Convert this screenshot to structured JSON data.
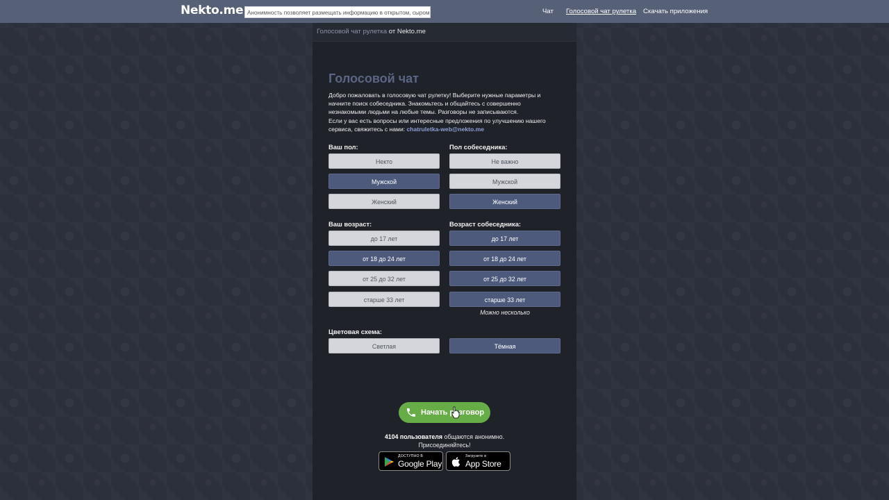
{
  "header": {
    "logo": "Nekto.me",
    "notice": "Анонимность позволяет размещать информацию в открытом, сыром виде!",
    "nav": [
      {
        "label": "Чат"
      },
      {
        "label": "Голосовой чат рулетка"
      },
      {
        "label": "Скачать приложения"
      }
    ]
  },
  "breadcrumb": {
    "link": "Голосовой чат рулетка",
    "rest": " от Nekto.me"
  },
  "main": {
    "title": "Голосовой чат",
    "intro_text": "Добро пожаловать в голосовую чат рулетку! Выберите нужные параметры и начните поиск собеседника. Знакомьтесь и общайтесь с совершенно незнакомыми людьми на любые темы. Разговоры не записываются.",
    "contact_text": "Если у вас есть вопросы или интересные предложения по улучшению нашего сервиса, свяжитесь с нами: ",
    "email": "chatruletka-web@nekto.me"
  },
  "your_sex": {
    "label": "Ваш пол:",
    "options": [
      "Некто",
      "Мужской",
      "Женский"
    ],
    "selected": "Мужской"
  },
  "partner_sex": {
    "label": "Пол собеседника:",
    "options": [
      "Не важно",
      "Мужской",
      "Женский"
    ],
    "selected": "Женский"
  },
  "your_age": {
    "label": "Ваш возраст:",
    "options": [
      "до 17 лет",
      "от 18 до 24 лет",
      "от 25 до 32 лет",
      "старше 33 лет"
    ],
    "selected": "от 18 до 24 лет"
  },
  "partner_age": {
    "label": "Возраст собеседника:",
    "options": [
      "до 17 лет",
      "от 18 до 24 лет",
      "от 25 до 32 лет",
      "старше 33 лет"
    ],
    "selected": [
      "до 17 лет",
      "от 18 до 24 лет",
      "от 25 до 32 лет",
      "старше 33 лет"
    ],
    "hint": "Можно несколько"
  },
  "color_scheme": {
    "label": "Цветовая схема:",
    "options": [
      "Светлая",
      "Тёмная"
    ],
    "selected": "Тёмная"
  },
  "start": {
    "label": "Начать разговор",
    "icon": "phone-icon"
  },
  "online": {
    "count_text": "4104 пользователя",
    "rest_text": " общаются анонимно.",
    "join_text": "Присоединяйтесь!"
  },
  "stores": {
    "google": {
      "small": "ДОСТУПНО В",
      "big": "Google Play",
      "icon": "google-play-icon"
    },
    "apple": {
      "small": "Загрузите в",
      "big": "App Store",
      "icon": "apple-icon"
    }
  },
  "colors": {
    "header_bg": "#566077",
    "selected_option": "#4d5a7c",
    "unselected_option": "#d4d6db",
    "start_button": "#66ad47",
    "title": "#5b6684",
    "email": "#8d9fd6"
  }
}
